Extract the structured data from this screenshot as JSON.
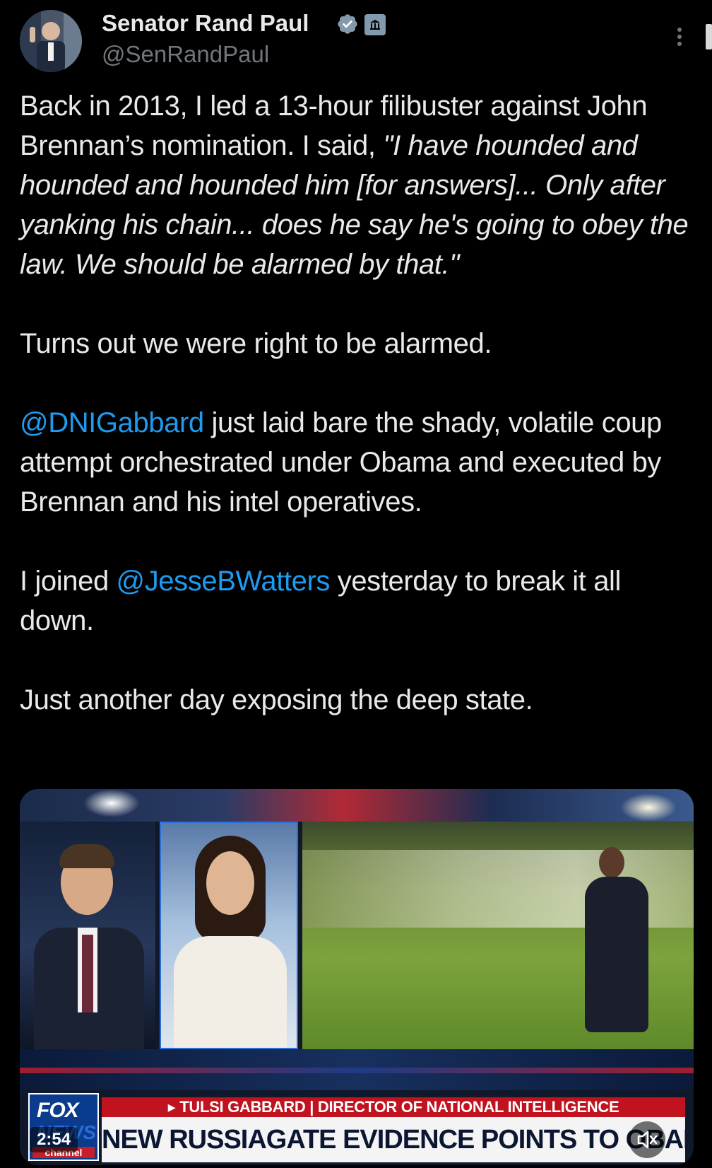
{
  "header": {
    "name": "Senator Rand Paul",
    "handle": "@SenRandPaul"
  },
  "tweet": {
    "p1_plain": "Back in 2013, I led a 13-hour filibuster against John Brennan’s nomination. I said, ",
    "p1_quote": "\"I have hounded and hounded and hounded him [for answers]... Only after yanking his chain... does he say he's going to obey the law. We should be alarmed by that.\"",
    "p2": "Turns out we were right to be alarmed.",
    "p3_mention": "@DNIGabbard",
    "p3_rest": " just laid bare the shady, volatile coup attempt orchestrated under Obama and executed by Brennan and his intel operatives.",
    "p4_pre": "I joined ",
    "p4_mention": "@JesseBWatters",
    "p4_rest": " yesterday to break it all down.",
    "p5": "Just another day exposing the deep state."
  },
  "video": {
    "logo_fox": "FOX",
    "logo_news": "NEWS",
    "logo_channel": "channel",
    "banner_top": "▸ TULSI GABBARD | DIRECTOR OF NATIONAL INTELLIGENCE",
    "banner_main": "NEW RUSSIAGATE EVIDENCE POINTS TO OBAMA",
    "timestamp": "2:54"
  },
  "icons": {
    "verified": "verified-badge-icon",
    "gov": "government-badge-icon",
    "more": "more-options-icon",
    "mute": "muted-speaker-icon"
  },
  "colors": {
    "background": "#000000",
    "text": "#e7e9ea",
    "secondary": "#71767b",
    "link": "#1d9bf0",
    "verified": "#829aab"
  }
}
